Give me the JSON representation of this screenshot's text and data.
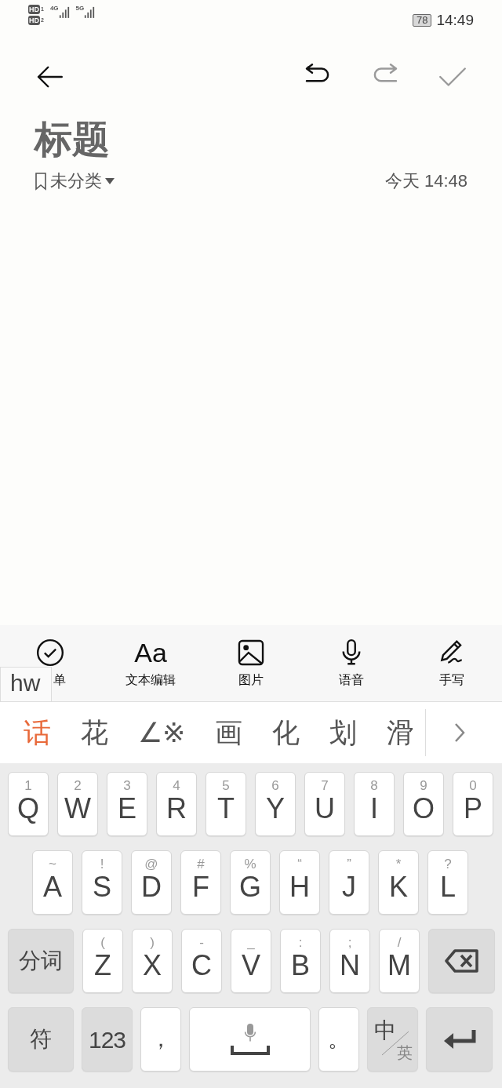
{
  "status_bar": {
    "sims": [
      {
        "label": "HD",
        "slot": "1"
      },
      {
        "label": "HD",
        "slot": "2"
      }
    ],
    "networks": [
      "4G",
      "5G"
    ],
    "battery": "78",
    "time": "14:49"
  },
  "toolbar": {
    "actions": [
      {
        "kind": "undo",
        "disabled": false
      },
      {
        "kind": "redo",
        "disabled": true
      },
      {
        "kind": "done",
        "disabled": true
      }
    ]
  },
  "note": {
    "title": "标题",
    "category": "未分类",
    "date": "今天 14:48"
  },
  "tools": [
    {
      "kind": "checklist",
      "label": "单"
    },
    {
      "kind": "text",
      "glyph": "Aa",
      "label": "文本编辑"
    },
    {
      "kind": "image",
      "label": "图片"
    },
    {
      "kind": "voice",
      "label": "语音"
    },
    {
      "kind": "handwrite",
      "label": "手写"
    }
  ],
  "hint_popup": "hw",
  "candidates": [
    {
      "text": "话",
      "selected": true
    },
    {
      "text": "花",
      "selected": false
    },
    {
      "text": "∠※",
      "selected": false
    },
    {
      "text": "画",
      "selected": false
    },
    {
      "text": "化",
      "selected": false
    },
    {
      "text": "划",
      "selected": false
    },
    {
      "text": "滑",
      "selected": false
    }
  ],
  "keyboard": {
    "rows": [
      {
        "keys": [
          {
            "kind": "letter",
            "label": "Q",
            "hint": "1"
          },
          {
            "kind": "letter",
            "label": "W",
            "hint": "2"
          },
          {
            "kind": "letter",
            "label": "E",
            "hint": "3"
          },
          {
            "kind": "letter",
            "label": "R",
            "hint": "4"
          },
          {
            "kind": "letter",
            "label": "T",
            "hint": "5"
          },
          {
            "kind": "letter",
            "label": "Y",
            "hint": "6"
          },
          {
            "kind": "letter",
            "label": "U",
            "hint": "7"
          },
          {
            "kind": "letter",
            "label": "I",
            "hint": "8"
          },
          {
            "kind": "letter",
            "label": "O",
            "hint": "9"
          },
          {
            "kind": "letter",
            "label": "P",
            "hint": "0"
          }
        ]
      },
      {
        "keys": [
          {
            "kind": "letter",
            "label": "A",
            "hint": "~"
          },
          {
            "kind": "letter",
            "label": "S",
            "hint": "!"
          },
          {
            "kind": "letter",
            "label": "D",
            "hint": "@"
          },
          {
            "kind": "letter",
            "label": "F",
            "hint": "#"
          },
          {
            "kind": "letter",
            "label": "G",
            "hint": "%"
          },
          {
            "kind": "letter",
            "label": "H",
            "hint": "“"
          },
          {
            "kind": "letter",
            "label": "J",
            "hint": "”"
          },
          {
            "kind": "letter",
            "label": "K",
            "hint": "*"
          },
          {
            "kind": "letter",
            "label": "L",
            "hint": "?"
          }
        ]
      },
      {
        "keys": [
          {
            "kind": "function",
            "label": "分词"
          },
          {
            "kind": "letter",
            "label": "Z",
            "hint": "("
          },
          {
            "kind": "letter",
            "label": "X",
            "hint": ")"
          },
          {
            "kind": "letter",
            "label": "C",
            "hint": "-"
          },
          {
            "kind": "letter",
            "label": "V",
            "hint": "_"
          },
          {
            "kind": "letter",
            "label": "B",
            "hint": ":"
          },
          {
            "kind": "letter",
            "label": "N",
            "hint": ";"
          },
          {
            "kind": "letter",
            "label": "M",
            "hint": "/"
          },
          {
            "kind": "backspace"
          }
        ]
      },
      {
        "keys": [
          {
            "kind": "function",
            "label": "符"
          },
          {
            "kind": "numbers",
            "label": "123"
          },
          {
            "kind": "punct",
            "label": "，"
          },
          {
            "kind": "space"
          },
          {
            "kind": "punct",
            "label": "。"
          },
          {
            "kind": "lang",
            "label": "中",
            "sub": "英"
          },
          {
            "kind": "enter"
          }
        ]
      }
    ]
  }
}
